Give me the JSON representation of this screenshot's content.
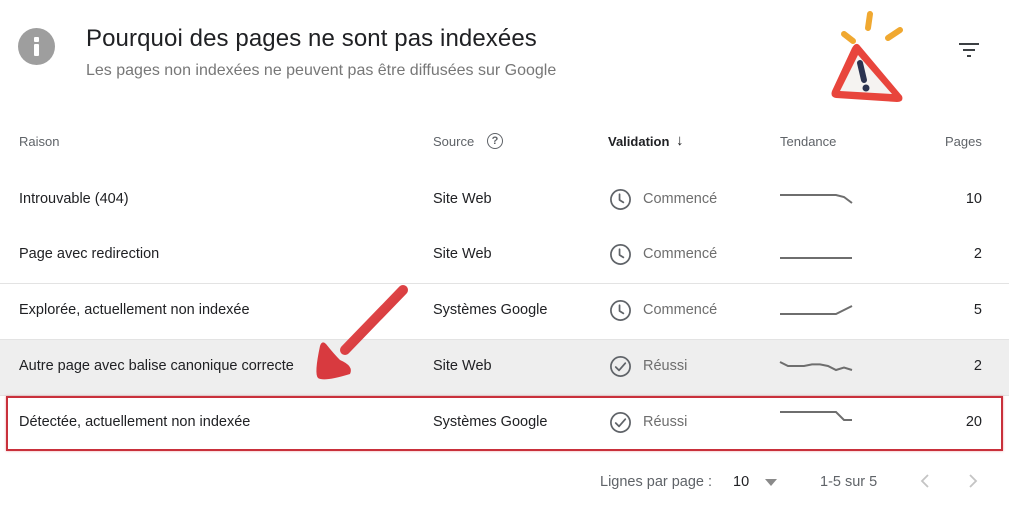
{
  "header": {
    "title": "Pourquoi des pages ne sont pas indexées",
    "subtitle": "Les pages non indexées ne peuvent pas être diffusées sur Google",
    "info_icon": "info-icon",
    "illustration": "warning-triangle-icon",
    "filter_icon": "filter-icon"
  },
  "table": {
    "columns": {
      "reason": "Raison",
      "source": "Source",
      "validation": "Validation",
      "trend": "Tendance",
      "pages": "Pages"
    },
    "sort": {
      "column": "validation",
      "direction": "descending"
    },
    "rows": [
      {
        "reason": "Introuvable (404)",
        "source": "Site Web",
        "status": "Commencé",
        "status_icon": "clock-icon",
        "pages": "10",
        "trend": [
          10,
          10,
          10,
          10,
          10,
          10,
          10,
          10,
          9.5,
          8
        ]
      },
      {
        "reason": "Page avec redirection",
        "source": "Site Web",
        "status": "Commencé",
        "status_icon": "clock-icon",
        "pages": "2",
        "trend": [
          2,
          2,
          2,
          2,
          2,
          2,
          2,
          2,
          2,
          2
        ]
      },
      {
        "reason": "Explorée, actuellement non indexée",
        "source": "Systèmes Google",
        "status": "Commencé",
        "status_icon": "clock-icon",
        "pages": "5",
        "trend": [
          4,
          4,
          4,
          4,
          4,
          4,
          4,
          4,
          4.5,
          5
        ]
      },
      {
        "reason": "Autre page avec balise canonique correcte",
        "source": "Site Web",
        "status": "Réussi",
        "status_icon": "check-circle-icon",
        "pages": "2",
        "trend": [
          3,
          2.5,
          2.5,
          2.5,
          2.7,
          2.7,
          2.5,
          2,
          2.3,
          2
        ]
      },
      {
        "reason": "Détectée, actuellement non indexée",
        "source": "Systèmes Google",
        "status": "Réussi",
        "status_icon": "check-circle-icon",
        "pages": "20",
        "trend": [
          22,
          22,
          22,
          22,
          22,
          22,
          22,
          22,
          20,
          20
        ]
      }
    ],
    "highlighted_row": 4,
    "hovered_row": 3
  },
  "pagination": {
    "rows_per_page_label": "Lignes par page :",
    "rows_per_page_value": "10",
    "range": "1-5 sur 5"
  },
  "colors": {
    "highlight": "#c9303b",
    "arrow": "#d83a3f",
    "hover_row": "#eeeeee"
  }
}
